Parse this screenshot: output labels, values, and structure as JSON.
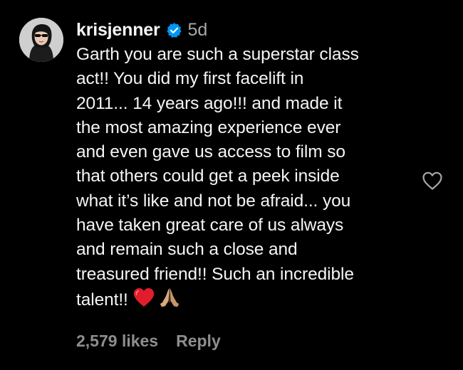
{
  "comment": {
    "username": "krisjenner",
    "verified": true,
    "time_ago": "5d",
    "lines": [
      "Garth you are such a superstar class",
      "act!! You did my first facelift in",
      "2011... 14 years ago!!! and made it",
      "the most amazing experience ever",
      "and even gave us access to film so",
      "that others could get a peek inside",
      "what it’s like and not be afraid... you",
      "have taken great care of us always",
      "and remain such a close and",
      "treasured friend!! Such an incredible",
      "talent!!"
    ],
    "emojis": [
      "red-heart",
      "folded-hands"
    ],
    "likes": "2,579 likes",
    "reply_label": "Reply"
  },
  "icons": {
    "verified": "verified-badge-icon",
    "like": "heart-outline-icon"
  },
  "colors": {
    "background": "#000000",
    "text": "#f5f5f5",
    "muted": "#a8a8a8",
    "verified_blue": "#0095f6",
    "heart_red": "#e0245e"
  }
}
